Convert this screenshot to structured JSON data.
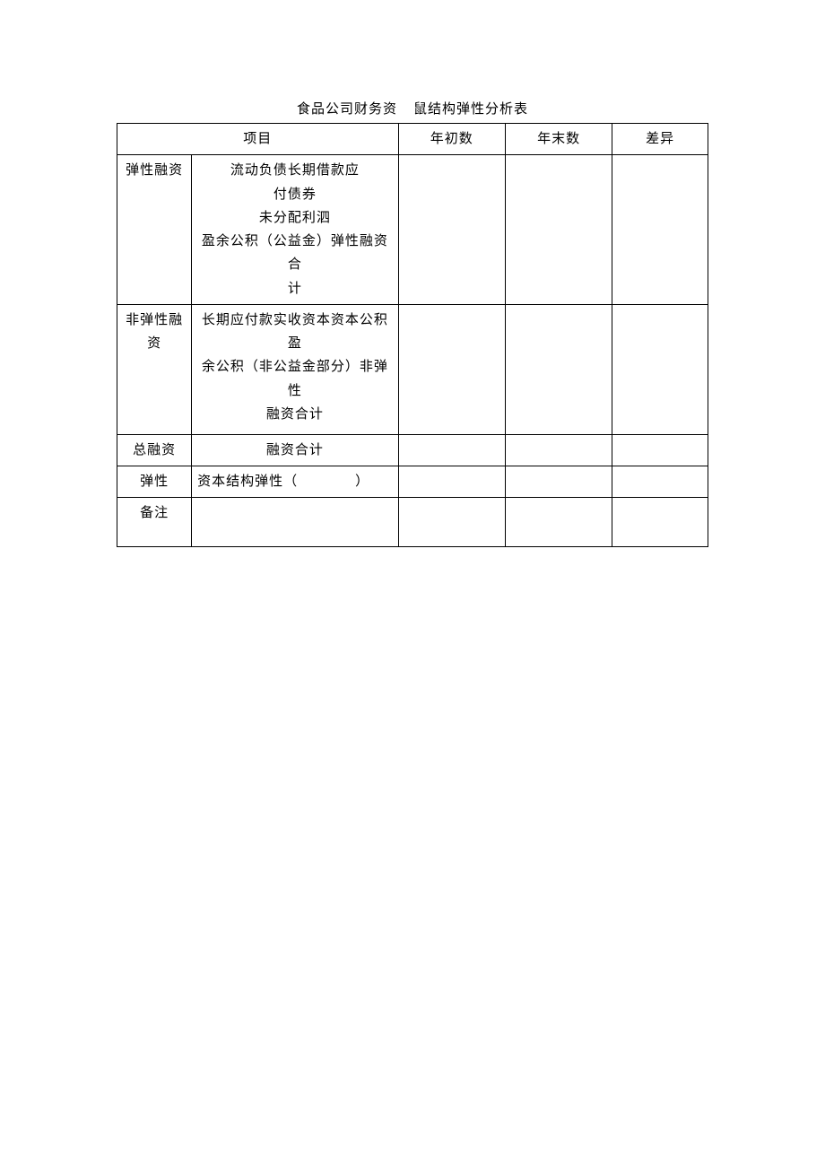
{
  "title": {
    "left": "食品公司财务资",
    "right": "鼠结构弹性分析表"
  },
  "headers": {
    "project": "项目",
    "begin": "年初数",
    "end": "年末数",
    "diff": "差异"
  },
  "rows": {
    "elastic": {
      "label": "弹性融资",
      "items": "流动负债长期借款应\n付债券\n未分配利泗\n盈余公积（公益金）弹性融资合\n计",
      "begin": "",
      "end": "",
      "diff": ""
    },
    "nonelastic": {
      "label": "非弹性融资",
      "items": "长期应付款实收资本资本公积盈\n余公积（非公益金部分）非弹性\n融资合计",
      "begin": "",
      "end": "",
      "diff": ""
    },
    "total": {
      "label": "总融资",
      "items": "融资合计",
      "begin": "",
      "end": "",
      "diff": ""
    },
    "elasticity": {
      "label": "弹性",
      "items": "资本结构弹性（　　　　）",
      "begin": "",
      "end": "",
      "diff": ""
    },
    "remark": {
      "label": "备注",
      "items": "",
      "begin": "",
      "end": "",
      "diff": ""
    }
  }
}
